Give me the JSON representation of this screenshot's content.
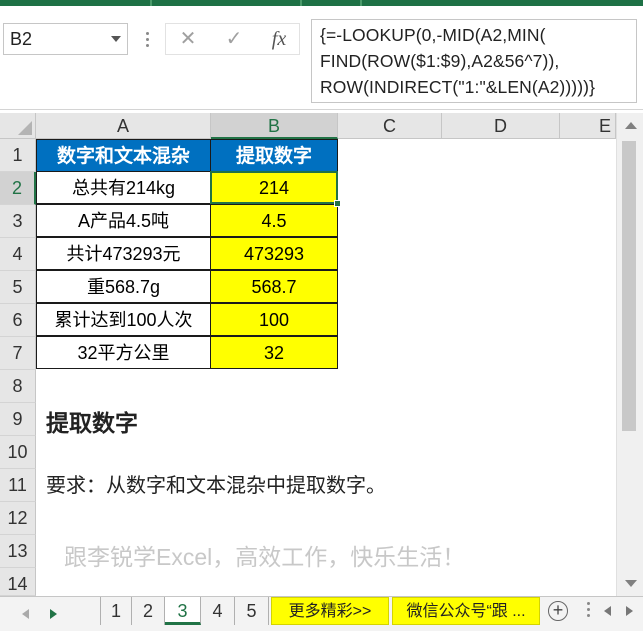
{
  "name_box": "B2",
  "formula_buttons": {
    "cancel": "✕",
    "enter": "✓",
    "function": "fx"
  },
  "formula_lines": [
    "{=-LOOKUP(0,-MID(A2,MIN(",
    "FIND(ROW($1:$9),A2&56^7)),",
    "ROW(INDIRECT(\"1:\"&LEN(A2)))))}"
  ],
  "columns": [
    "A",
    "B",
    "C",
    "D",
    "E"
  ],
  "rows": [
    "1",
    "2",
    "3",
    "4",
    "5",
    "6",
    "7",
    "8",
    "9",
    "10",
    "11",
    "12",
    "13",
    "14"
  ],
  "table": {
    "header": [
      "数字和文本混杂",
      "提取数字"
    ],
    "data": [
      [
        "总共有214kg",
        "214"
      ],
      [
        "A产品4.5吨",
        "4.5"
      ],
      [
        "共计473293元",
        "473293"
      ],
      [
        "重568.7g",
        "568.7"
      ],
      [
        "累计达到100人次",
        "100"
      ],
      [
        "32平方公里",
        "32"
      ]
    ]
  },
  "title_text": "提取数字",
  "requirement_text": "要求：从数字和文本混杂中提取数字。",
  "watermark_text": "跟李锐学Excel，高效工作，快乐生活！",
  "sheet_tabs": [
    "1",
    "2",
    "3",
    "4",
    "5"
  ],
  "active_sheet": "3",
  "extra_tabs": [
    "更多精彩>>",
    "微信公众号“跟 ..."
  ],
  "add_sheet": "+",
  "colors": {
    "accent": "#217346",
    "header_fill": "#0070c0",
    "highlight": "#ffff00"
  }
}
